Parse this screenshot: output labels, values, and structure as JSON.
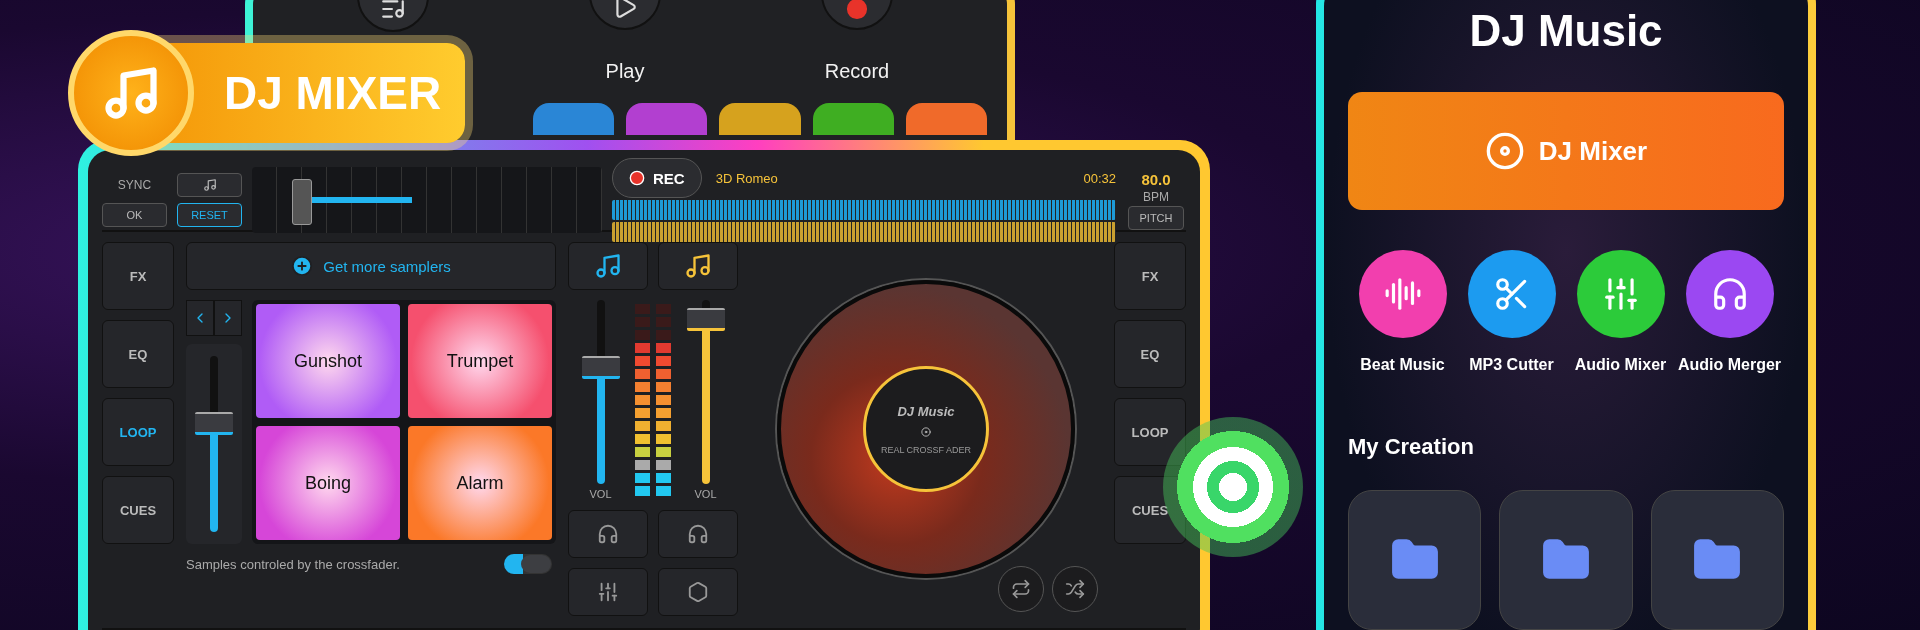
{
  "badge": {
    "title": "DJ MIXER"
  },
  "back_tablet": {
    "controls": [
      {
        "kind": "playlist"
      },
      {
        "kind": "play",
        "label": "Play"
      },
      {
        "kind": "record",
        "label": "Record"
      }
    ],
    "pads": [
      {
        "color": "#2a86d6"
      },
      {
        "color": "#b23fd0"
      },
      {
        "color": "#d6a21e"
      },
      {
        "color": "#3fae22"
      },
      {
        "color": "#f06a2a"
      }
    ]
  },
  "deck": {
    "sync": "SYNC",
    "ok": "OK",
    "reset": "RESET",
    "rec": "REC",
    "track": "3D Romeo",
    "time": "00:32",
    "bpm": "80.0",
    "bpm_unit": "BPM",
    "pitch": "PITCH",
    "left_buttons": [
      {
        "label": "FX",
        "selected": false
      },
      {
        "label": "EQ",
        "selected": false
      },
      {
        "label": "LOOP",
        "selected": true
      },
      {
        "label": "CUES",
        "selected": false
      }
    ],
    "get_more": "Get more samplers",
    "samplers": [
      {
        "label": "Gunshot",
        "color": "#b05cf6"
      },
      {
        "label": "Trumpet",
        "color": "#f5506e"
      },
      {
        "label": "Boing",
        "color": "#d646d8"
      },
      {
        "label": "Alarm",
        "color": "#fb7828"
      }
    ],
    "sampler_volume": {
      "level": 0.6
    },
    "crossfader_note": "Samples controled by the crossfader.",
    "crossfader_toggle": {
      "on": true
    },
    "volume_a": {
      "label": "VOL",
      "level": 0.62
    },
    "volume_b": {
      "label": "VOL",
      "level": 0.88
    },
    "disc": {
      "title": "DJ Music",
      "subtitle": "REAL CROSSF ADER"
    },
    "right_buttons": [
      {
        "label": "FX",
        "selected": false
      },
      {
        "label": "EQ",
        "selected": false
      },
      {
        "label": "LOOP",
        "selected": false
      },
      {
        "label": "CUES",
        "selected": false
      }
    ]
  },
  "phone": {
    "title": "DJ Music",
    "main_button": "DJ Mixer",
    "tools": [
      {
        "kind": "bars",
        "label": "Beat Music",
        "color": "#f23fae"
      },
      {
        "kind": "scissors",
        "label": "MP3 Cutter",
        "color": "#1c9bf0"
      },
      {
        "kind": "sliders",
        "label": "Audio Mixer",
        "color": "#2ccb3a"
      },
      {
        "kind": "headphones",
        "label": "Audio Merger",
        "color": "#9b48f2"
      }
    ],
    "section": "My Creation",
    "creations": [
      {
        "kind": "folder"
      },
      {
        "kind": "folder"
      },
      {
        "kind": "folder"
      }
    ]
  }
}
